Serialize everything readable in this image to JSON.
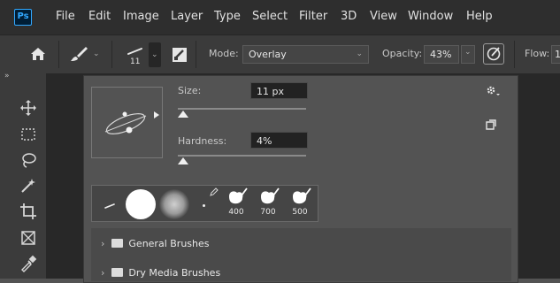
{
  "app": {
    "logo_text": "Ps"
  },
  "menu": [
    "File",
    "Edit",
    "Image",
    "Layer",
    "Type",
    "Select",
    "Filter",
    "3D",
    "View",
    "Window",
    "Help"
  ],
  "options_bar": {
    "brush_size_value": "11",
    "mode_label": "Mode:",
    "mode_value": "Overlay",
    "opacity_label": "Opacity:",
    "opacity_value": "43%",
    "flow_label": "Flow:",
    "flow_value": "1"
  },
  "brush_panel": {
    "size_label": "Size:",
    "size_value": "11 px",
    "size_slider_fraction": 0.04,
    "hardness_label": "Hardness:",
    "hardness_value": "4%",
    "hardness_slider_fraction": 0.04,
    "preset_numbers": [
      "400",
      "700",
      "500"
    ],
    "folders": [
      {
        "label": "General Brushes"
      },
      {
        "label": "Dry Media Brushes"
      }
    ]
  },
  "icons": [
    "home-icon",
    "brush-icon",
    "brush-settings-icon",
    "pressure-opacity-icon",
    "move-icon",
    "marquee-icon",
    "lasso-icon",
    "magic-wand-icon",
    "crop-icon",
    "frame-icon",
    "eyedropper-icon",
    "gear-icon",
    "new-preset-icon"
  ]
}
